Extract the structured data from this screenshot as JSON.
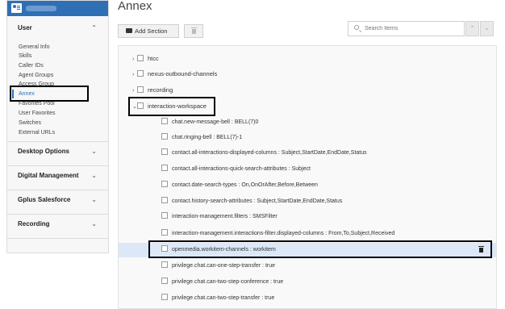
{
  "sidebar": {
    "sections": {
      "user": {
        "title": "User",
        "chevron": "up"
      },
      "desktop_options": {
        "title": "Desktop Options",
        "chevron": "down"
      },
      "digital_management": {
        "title": "Digital Management",
        "chevron": "down"
      },
      "gplus_salesforce": {
        "title": "Gplus Salesforce",
        "chevron": "down"
      },
      "recording": {
        "title": "Recording",
        "chevron": "down"
      }
    },
    "items": [
      "General Info",
      "Skills",
      "Caller IDs",
      "Agent Groups",
      "Access Group",
      "Annex",
      "Favorites Pool",
      "User Favorites",
      "Switches",
      "External URLs"
    ],
    "active_item": "Annex"
  },
  "main": {
    "title": "Annex",
    "add_section_label": "Add Section",
    "search_placeholder": "Search Items",
    "sections": [
      "htcc",
      "nexus-outbound-channels",
      "recording",
      "interaction-workspace"
    ],
    "expanded_section": "interaction-workspace",
    "items": [
      "chat.new-message-bell : BELL(7)0",
      "chat.ringing-bell : BELL(7)-1",
      "contact.all-interactions-displayed-columns : Subject,StartDate,EndDate,Status",
      "contact.all-interactions-quick-search-attributes : Subject",
      "contact.date-search-types : On,OnOrAfter,Before,Between",
      "contact.history-search-attributes : Subject,StartDate,EndDate,Status",
      "interaction-management.filters : SMSFilter",
      "interaction-management.interactions-filter.displayed-columns : From,To,Subject,Received",
      "openmedia.workitem-channels : workitem",
      "privilege.chat.can-one-step-transfer : true",
      "privilege.chat.can-two-step-conference : true",
      "privilege.chat.can-two-step-transfer : true"
    ],
    "selected_item_index": 8
  },
  "colors": {
    "header_blue": "#2f6fb5",
    "selected_row": "#dce8f7",
    "annotation_box": "#000000"
  }
}
